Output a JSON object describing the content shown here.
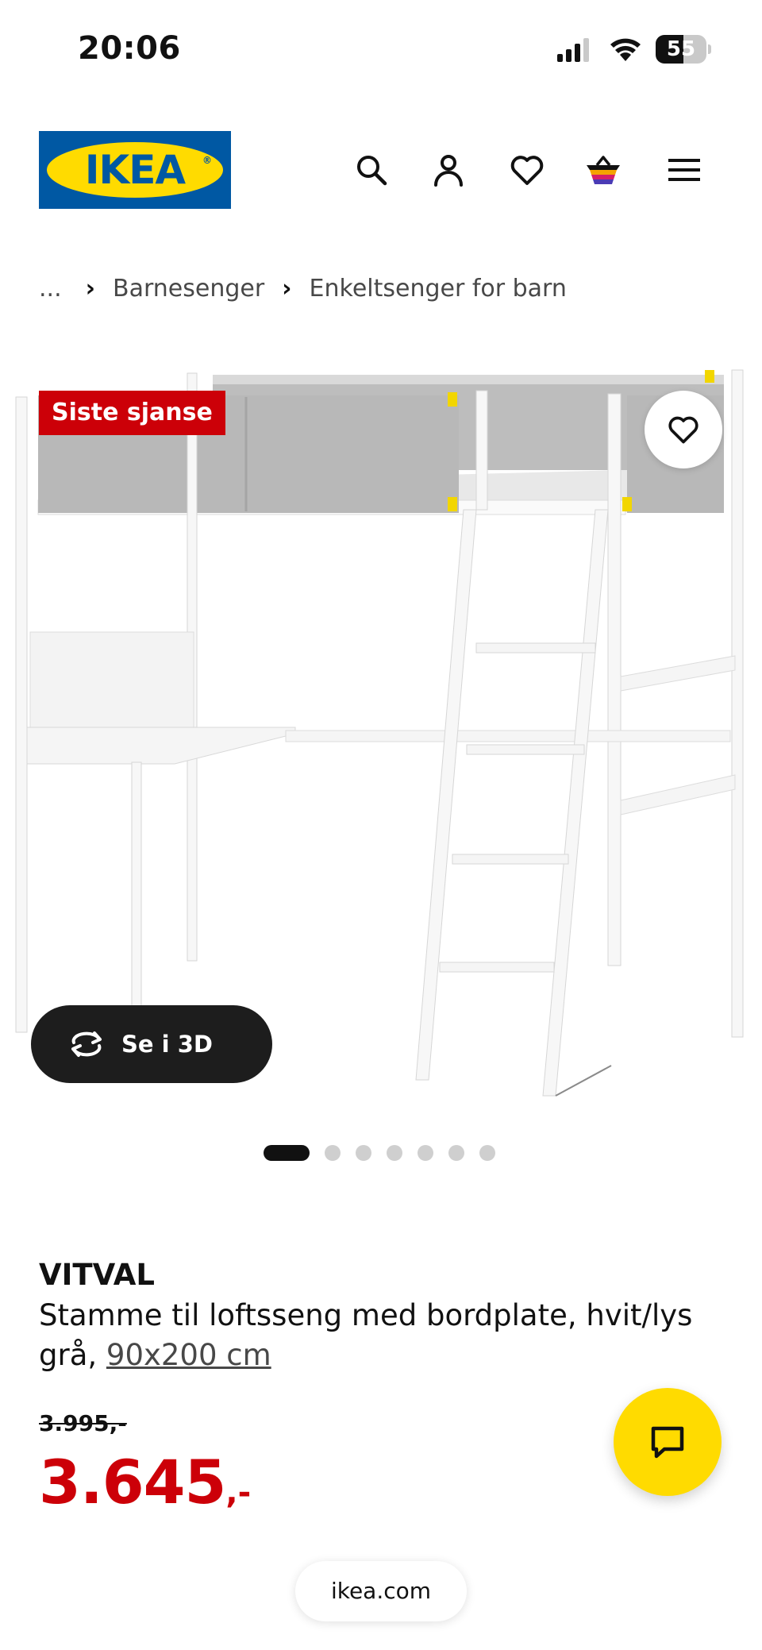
{
  "status_bar": {
    "time": "20:06",
    "battery_level": "55",
    "battery_fraction": 0.55,
    "icons": [
      "signal-icon",
      "wifi-icon",
      "battery-icon"
    ]
  },
  "header": {
    "logo_text": "IKEA",
    "logo_registered": "®",
    "icons": [
      "search-icon",
      "account-icon",
      "heart-icon",
      "cart-icon",
      "menu-icon"
    ],
    "colors": {
      "blue": "#0058a3",
      "yellow": "#ffdb00"
    }
  },
  "breadcrumb": {
    "ellipsis": "...",
    "items": [
      "Barnesenger",
      "Enkeltsenger for barn"
    ],
    "separator": "›"
  },
  "gallery": {
    "badge": "Siste sjanse",
    "view_3d_label": "Se i 3D",
    "slide_count": 7,
    "active_slide": 1
  },
  "product": {
    "name": "VITVAL",
    "description": "Stamme til loftsseng med bordplate, hvit/lys grå,",
    "size": "90x200 cm",
    "old_price": "3.995,-",
    "price": "3.645",
    "price_suffix": ",-"
  },
  "browser": {
    "url": "ikea.com"
  },
  "colors": {
    "price_red": "#cc0008",
    "chat_yellow": "#ffdb00"
  }
}
